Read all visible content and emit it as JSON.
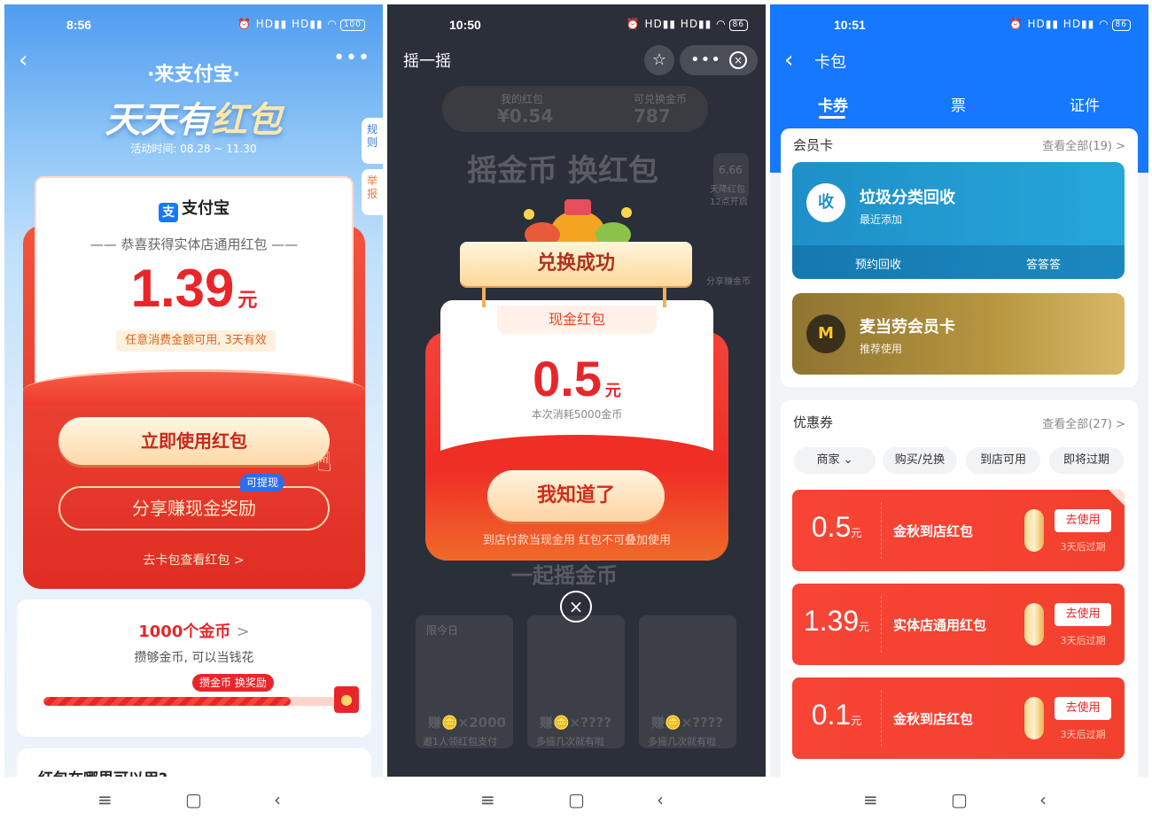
{
  "screen1": {
    "status_time": "8:56",
    "status_icons": "⏰ HD▮▮ HD▮▮ ◠",
    "battery": "100",
    "back_glyph": "‹",
    "more_glyph": "•••",
    "title_small": "·来支付宝·",
    "title_big_prefix": "天天有",
    "title_big_highlight": "红包",
    "period": "活动时间: 08.28 ~ 11.30",
    "side_rules": "规则",
    "side_report": "举报",
    "brand": "支付宝",
    "brand_logo_glyph": "支",
    "congrats": "—— 恭喜获得实体店通用红包 ——",
    "amount": "1.39",
    "unit": "元",
    "validity": "任意消费金额可用, 3天有效",
    "use_button": "立即使用红包",
    "share_button": "分享赚现金奖励",
    "withdraw_badge": "可提现",
    "wallet_link": "去卡包查看红包 >",
    "coins_title": "1000个金币",
    "coins_chevron": ">",
    "coins_sub": "攒够金币, 可以当钱花",
    "progress_tip": "攒金币 换奖励",
    "progress_fraction": 0.82,
    "where_title": "红包在哪里可以用?",
    "accent_color": "#e8262a",
    "icons": [
      "back-arrow-icon",
      "more-icon",
      "hand-pointer-icon",
      "gift-icon"
    ]
  },
  "screen2": {
    "status_time": "10:50",
    "status_icons": "⏰ HD▮▮ HD▮▮ ◠",
    "battery": "86",
    "title": "摇一摇",
    "star_glyph": "☆",
    "more_glyph": "•••",
    "close_glyph": "×",
    "bg_my_redpacket_label": "我的红包",
    "bg_my_redpacket_value": "¥0.54",
    "bg_coins_label": "可兑换金币",
    "bg_coins_value": "787",
    "bg_headline": "摇金币 换红包",
    "bg_badge": "6.66",
    "bg_badge_sub": "天降红包",
    "bg_badge_time": "12点开启",
    "bg_share": "分享赚金币",
    "bg_bottom_text": "一起摇金币",
    "bg_task1_tag": "限今日",
    "bg_task1_reward": "赚🪙×2000",
    "bg_task1_desc": "邀1人领红包支付",
    "bg_task2_reward": "赚🪙×????",
    "bg_task2_desc": "多摇几次就有啦",
    "bg_task3_reward": "赚🪙×????",
    "bg_task3_desc": "多摇几次就有啦",
    "banner": "兑换成功",
    "cash_tab": "现金红包",
    "amount": "0.5",
    "unit": "元",
    "cost": "本次消耗5000金币",
    "ok_button": "我知道了",
    "note": "到店付款当现金用 红包不可叠加使用",
    "modal_close_glyph": "×"
  },
  "screen3": {
    "status_time": "10:51",
    "status_icons": "⏰ HD▮▮ HD▮▮ ◠",
    "battery": "86",
    "back_glyph": "‹",
    "title": "卡包",
    "tabs": [
      "卡券",
      "票",
      "证件"
    ],
    "member_section_title": "会员卡",
    "member_section_more": "查看全部(19) >",
    "card1_icon_glyph": "收",
    "card1_name": "垃圾分类回收",
    "card1_sub": "最近添加",
    "card1_action1": "预约回收",
    "card1_action2": "答答答",
    "card2_icon_glyph": "M",
    "card2_name": "麦当劳会员卡",
    "card2_sub": "推荐使用",
    "coupon_section_title": "优惠券",
    "coupon_section_more": "查看全部(27) >",
    "filters": [
      "商家 ⌄",
      "购买/兑换",
      "到店可用",
      "即将过期"
    ],
    "coupons": [
      {
        "amount": "0.5",
        "unit": "元",
        "name": "金秋到店红包",
        "button": "去使用",
        "expiry": "3天后过期"
      },
      {
        "amount": "1.39",
        "unit": "元",
        "name": "实体店通用红包",
        "button": "去使用",
        "expiry": "3天后过期"
      },
      {
        "amount": "0.1",
        "unit": "元",
        "name": "金秋到店红包",
        "button": "去使用",
        "expiry": "3天后过期"
      }
    ],
    "brand_color": "#1677ff"
  },
  "navbar": {
    "menu": "≡",
    "home": "▢",
    "back": "‹"
  }
}
